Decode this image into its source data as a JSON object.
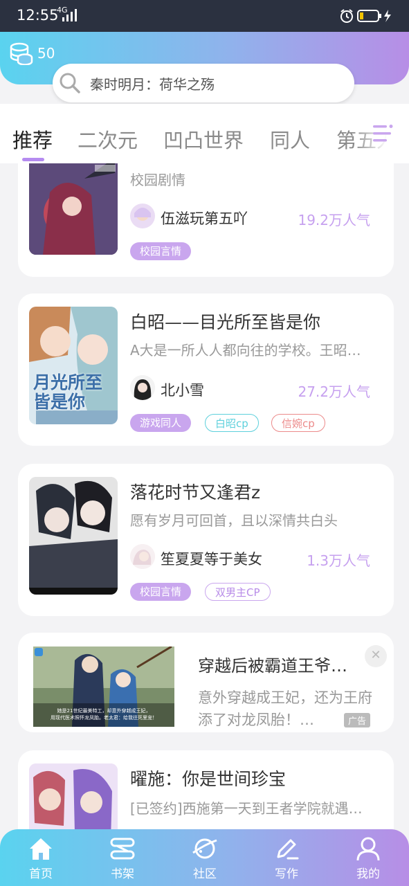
{
  "status": {
    "time": "12:55",
    "network": "4G"
  },
  "header": {
    "coins": "50",
    "search_placeholder": "秦时明月：荷华之殇"
  },
  "tabs": [
    {
      "label": "推荐",
      "active": true
    },
    {
      "label": "二次元"
    },
    {
      "label": "凹凸世界"
    },
    {
      "label": "同人"
    },
    {
      "label": "第五人"
    }
  ],
  "books": [
    {
      "title": "",
      "desc": "校园剧情",
      "author": "伍滋玩第五吖",
      "popularity": "19.2万人气",
      "tags": [
        "校园言情"
      ]
    },
    {
      "title": "白昭——目光所至皆是你",
      "desc": "A大是一所人人都向往的学校。王昭…",
      "author": "北小雪",
      "popularity": "27.2万人气",
      "tags": [
        "游戏同人",
        "白昭cp",
        "信婉cp"
      ],
      "cover_text": "月光所至皆是你"
    },
    {
      "title": "落花时节又逢君z",
      "desc": "愿有岁月可回首，且以深情共白头",
      "author": "笙夏夏等于美女",
      "popularity": "1.3万人气",
      "tags": [
        "校园言情",
        "双男主CP"
      ]
    },
    {
      "title": "曜施：你是世间珍宝",
      "desc": "[已签约]西施第一天到王者学院就遇…"
    }
  ],
  "ad": {
    "title": "穿越后被霸道王爷…",
    "desc": "意外穿越成王妃，还为王府添了对龙凤胎！…",
    "badge": "广告",
    "close": "✕",
    "img_caption_1": "她是21世纪最美特工，却意外穿越成王妃，",
    "img_caption_2": "用现代医术照怀龙凤胎。老太君：给我往死里宠！"
  },
  "nav": [
    {
      "label": "首页",
      "icon": "home-icon"
    },
    {
      "label": "书架",
      "icon": "bookshelf-icon"
    },
    {
      "label": "社区",
      "icon": "planet-icon"
    },
    {
      "label": "写作",
      "icon": "pen-icon"
    },
    {
      "label": "我的",
      "icon": "profile-icon"
    }
  ],
  "colors": {
    "accent": "#b58bf0",
    "gradient_start": "#5ad3ef",
    "gradient_end": "#b78ee6",
    "popularity": "#c6a0ef"
  }
}
